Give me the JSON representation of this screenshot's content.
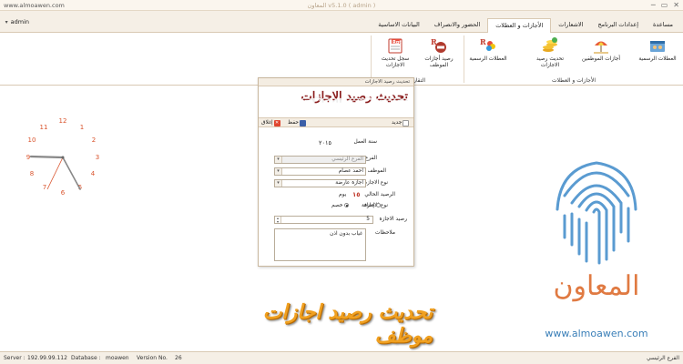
{
  "titlebar": {
    "title": "المعاون v5.1.0 ( admin )",
    "site": "www.almoawen.com",
    "minimize": "─",
    "maximize": "▭",
    "close": "✕"
  },
  "user": {
    "name": "admin"
  },
  "tabs": [
    {
      "label": "البيانات الاساسية",
      "active": false
    },
    {
      "label": "الحضور والانصراف",
      "active": false
    },
    {
      "label": "الأجازات و العطلات",
      "active": true
    },
    {
      "label": "الاشعارات",
      "active": false
    },
    {
      "label": "إعدادات البرنامج",
      "active": false
    },
    {
      "label": "مساعدة",
      "active": false
    }
  ],
  "ribbon": {
    "group_holidays": {
      "title": "الأجازات و العطلات",
      "buttons": [
        "العطلات الرسمية",
        "أجازات الموظفين",
        "تحديث رصيد الاجازات",
        "العطلات الرسمية"
      ]
    },
    "group_reports": {
      "title": "التقارير",
      "buttons": [
        "رصيد أجازات الموظف",
        "سجل تحديث الاجازات"
      ]
    }
  },
  "clock": {
    "numbers": [
      "12",
      "1",
      "2",
      "3",
      "4",
      "5",
      "6",
      "7",
      "8",
      "9",
      "10",
      "11"
    ]
  },
  "dialog": {
    "window_title": "تحديث رصيد الاجازات",
    "heading": "تحديث رصيد الاجازات",
    "toolbar": {
      "new": "جديد",
      "save": "حفظ",
      "close": "إغلاق"
    },
    "fields": {
      "year_label": "سنة العمل",
      "year_value": "٢٠١٥",
      "branch_label": "الفرع",
      "branch_value": "الفرع الرئيسي",
      "employee_label": "الموظف",
      "employee_value": "احمد عصام",
      "leave_type_label": "نوع الاجازة",
      "leave_type_value": "اجازة عارضة",
      "current_balance_label": "الرصيد الحالي",
      "current_balance_value": "١٥",
      "current_balance_unit": "يوم",
      "op_type_label": "نوع الاجازة",
      "op_add": "إضافة",
      "op_deduct": "خصم",
      "leave_balance_label": "رصيد الاجازة",
      "leave_balance_value": "5",
      "notes_label": "ملاحظات",
      "notes_value": "غياب بدون اذن"
    }
  },
  "overlay": {
    "title": "تحديث رصيد اجازات موظف",
    "brand_ar": "المعاون",
    "brand_url": "www.almoawen.com"
  },
  "statusbar": {
    "server_label": "Server :",
    "server_value": "192.99.99.112",
    "database_label": "Database :",
    "database_value": "moawen",
    "version_label": "Version No.",
    "version_value": "26",
    "branch": "الفرع الرئيسي"
  },
  "colors": {
    "accent_title": "#8a1c1c",
    "brand_orange": "#e07a42",
    "overlay_gold": "#f0a020",
    "url_blue": "#3a7fb8"
  }
}
